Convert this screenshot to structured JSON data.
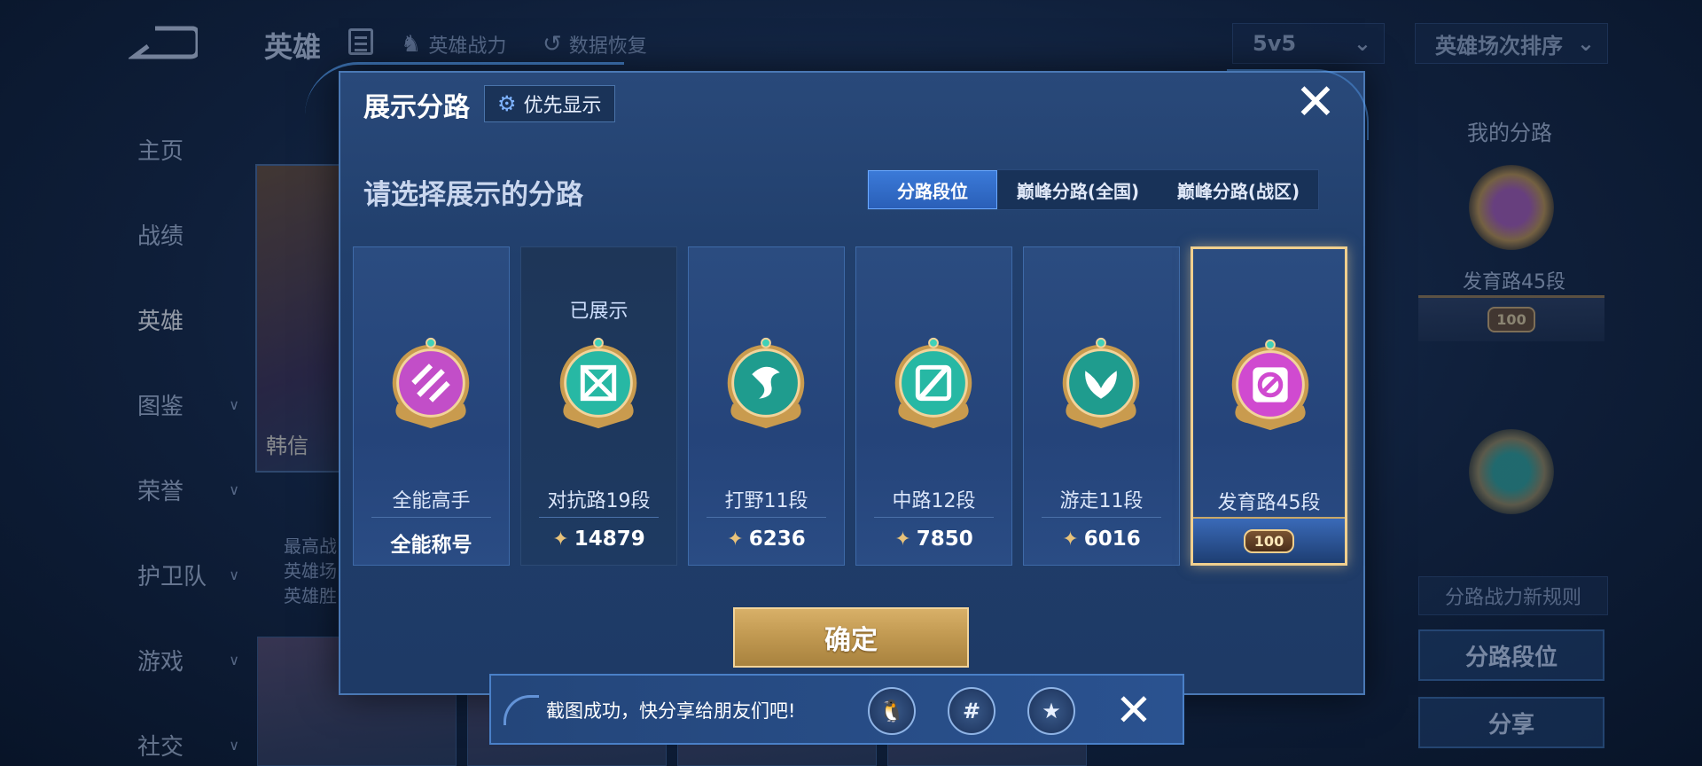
{
  "background": {
    "title": "英雄",
    "links": [
      {
        "label": "英雄战力",
        "icon": "helmet-icon"
      },
      {
        "label": "数据恢复",
        "icon": "restore-icon"
      }
    ],
    "mode_select": "5v5",
    "sort_select": "英雄场次排序",
    "nav": [
      {
        "label": "主页",
        "active": false,
        "has_children": false
      },
      {
        "label": "战绩",
        "active": false,
        "has_children": false
      },
      {
        "label": "英雄",
        "active": true,
        "has_children": false
      },
      {
        "label": "图鉴",
        "active": false,
        "has_children": true
      },
      {
        "label": "荣誉",
        "active": false,
        "has_children": true
      },
      {
        "label": "护卫队",
        "active": false,
        "has_children": true
      },
      {
        "label": "游戏",
        "active": false,
        "has_children": true
      },
      {
        "label": "社交",
        "active": false,
        "has_children": true
      }
    ],
    "hero_name": "韩信",
    "hero_info": [
      "最高战",
      "英雄场",
      "英雄胜"
    ],
    "right_panel": {
      "title": "我的分路",
      "badge_label": "发育路45段",
      "plate_value": "100",
      "rule_button": "分路战力新规则",
      "lane_rank_button": "分路段位",
      "share_button": "分享"
    }
  },
  "modal": {
    "title": "展示分路",
    "priority_button": "优先显示",
    "subtitle": "请选择展示的分路",
    "tabs": [
      {
        "label": "分路段位",
        "active": true
      },
      {
        "label": "巅峰分路(全国)",
        "active": false
      },
      {
        "label": "巅峰分路(战区)",
        "active": false
      }
    ],
    "cards": [
      {
        "tag": "",
        "name": "全能高手",
        "footer": "全能称号",
        "power": false,
        "badge_color": "#c24ec8",
        "symbol": "diagonal"
      },
      {
        "tag": "已展示",
        "name": "对抗路19段",
        "footer": "14879",
        "power": true,
        "badge_color": "#27b8a4",
        "symbol": "cross"
      },
      {
        "tag": "",
        "name": "打野11段",
        "footer": "6236",
        "power": true,
        "badge_color": "#1f9c8e",
        "symbol": "dragon"
      },
      {
        "tag": "",
        "name": "中路12段",
        "footer": "7850",
        "power": true,
        "badge_color": "#27b8a4",
        "symbol": "slash"
      },
      {
        "tag": "",
        "name": "游走11段",
        "footer": "6016",
        "power": true,
        "badge_color": "#1f9c8e",
        "symbol": "wings"
      },
      {
        "tag": "",
        "name": "发育路45段",
        "footer_plate": "100",
        "power": false,
        "badge_color": "#d04ad0",
        "symbol": "no-entry",
        "selected": true
      }
    ],
    "confirm_button": "确定"
  },
  "toast": {
    "message": "截图成功，快分享给朋友们吧!",
    "buttons": [
      {
        "name": "qq-share-button",
        "icon": "penguin-icon",
        "glyph": "🐧"
      },
      {
        "name": "moments-share-button",
        "icon": "hashtag-icon",
        "glyph": "#"
      },
      {
        "name": "qzone-share-button",
        "icon": "star-icon",
        "glyph": "★"
      }
    ]
  },
  "colors": {
    "accent": "#3b7ad8",
    "gold": "#f0cf8e",
    "power": "#e8c27a"
  }
}
